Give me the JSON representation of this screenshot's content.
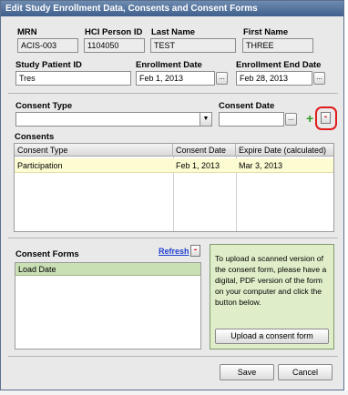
{
  "window": {
    "title": "Edit Study Enrollment Data, Consents and Consent Forms"
  },
  "header": {
    "mrn_label": "MRN",
    "mrn_value": "ACIS-003",
    "hci_label": "HCI Person ID",
    "hci_value": "1104050",
    "last_label": "Last Name",
    "last_value": "TEST",
    "first_label": "First Name",
    "first_value": "THREE",
    "study_pid_label": "Study Patient ID",
    "study_pid_value": "Tres",
    "enroll_date_label": "Enrollment Date",
    "enroll_date_value": "Feb 1, 2013",
    "enroll_end_label": "Enrollment End Date",
    "enroll_end_value": "Feb 28, 2013",
    "date_button": "..."
  },
  "consent_form": {
    "type_label": "Consent Type",
    "type_value": "",
    "date_label": "Consent Date",
    "date_value": "",
    "add_symbol": "+",
    "remove_symbol": "-"
  },
  "consents": {
    "title": "Consents",
    "columns": [
      "Consent Type",
      "Consent Date",
      "Expire Date (calculated)"
    ],
    "rows": [
      {
        "type": "Participation",
        "date": "Feb 1, 2013",
        "expire": "Mar 3, 2013"
      }
    ]
  },
  "consent_forms": {
    "title": "Consent Forms",
    "refresh_label": "Refresh",
    "remove_symbol": "-",
    "columns": [
      "Load Date"
    ]
  },
  "upload": {
    "text": "To upload a scanned version of the consent form, please have a digital, PDF version of the form on your computer and click the button below.",
    "button_label": "Upload a consent form"
  },
  "footer": {
    "save_label": "Save",
    "cancel_label": "Cancel"
  }
}
